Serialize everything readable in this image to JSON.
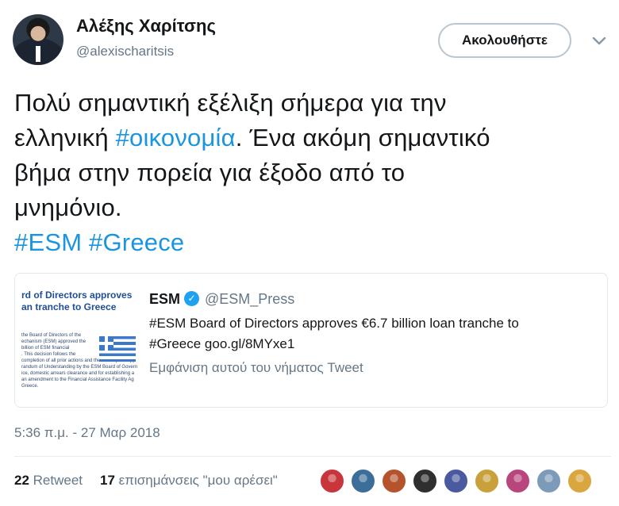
{
  "author": {
    "name": "Αλέξης Χαρίτσης",
    "handle": "@alexischaritsis"
  },
  "follow_button": "Ακολουθήστε",
  "tweet": {
    "lines": [
      [
        {
          "t": "Πολύ σημαντική εξέλιξη σήμερα για την"
        }
      ],
      [
        {
          "t": "ελληνική "
        },
        {
          "t": "#οικονομία",
          "tag": true
        },
        {
          "t": ". Ένα ακόμη σημαντικό"
        }
      ],
      [
        {
          "t": "βήμα στην πορεία για έξοδο από το"
        }
      ],
      [
        {
          "t": "μνημόνιο."
        }
      ],
      [
        {
          "t": "#ESM",
          "tag": true
        },
        {
          "t": " "
        },
        {
          "t": "#Greece",
          "tag": true
        }
      ]
    ]
  },
  "quoted": {
    "thumb_title_1": "rd of Directors approves",
    "thumb_title_2": "an tranche to Greece",
    "thumb_body": [
      "the Board of Directors of the",
      "echanism (ESM) approved the",
      "billion of ESM financial",
      ". This decision follows the",
      "completion of all prior actions and the subsequent app",
      "randum of Understanding by the ESM Board of Govern",
      "ice, domestic arrears clearance and for establishing a",
      "an amendment to the Financial Assistance Facility Ag",
      "Greece."
    ],
    "name": "ESM",
    "verified_glyph": "✓",
    "handle": "@ESM_Press",
    "text_line_1": "#ESM Board of Directors approves €6.7 billion loan tranche to",
    "text_line_2": "#Greece goo.gl/8MYxe1",
    "show_thread": "Εμφάνιση αυτού του νήματος Tweet"
  },
  "timestamp": "5:36 π.μ. - 27 Μαρ 2018",
  "stats": {
    "retweets_count": "22",
    "retweets_label": "Retweet",
    "likes_count": "17",
    "likes_label": "επισημάνσεις \"μου αρέσει\""
  },
  "liker_avatars": [
    {
      "name": "liker-avatar-1",
      "color": "#c8353b"
    },
    {
      "name": "liker-avatar-2",
      "color": "#3d6e9a"
    },
    {
      "name": "liker-avatar-3",
      "color": "#b5542c"
    },
    {
      "name": "liker-avatar-4",
      "color": "#2f2f2f"
    },
    {
      "name": "liker-avatar-5",
      "color": "#4a5aa0"
    },
    {
      "name": "liker-avatar-6",
      "color": "#c9a13a"
    },
    {
      "name": "liker-avatar-7",
      "color": "#b8467d"
    },
    {
      "name": "liker-avatar-8",
      "color": "#7d9bb8"
    },
    {
      "name": "liker-avatar-9",
      "color": "#d9a640"
    }
  ],
  "colors": {
    "link": "#1b95e0",
    "secondary_text": "#657786",
    "verified": "#1da1f2"
  }
}
